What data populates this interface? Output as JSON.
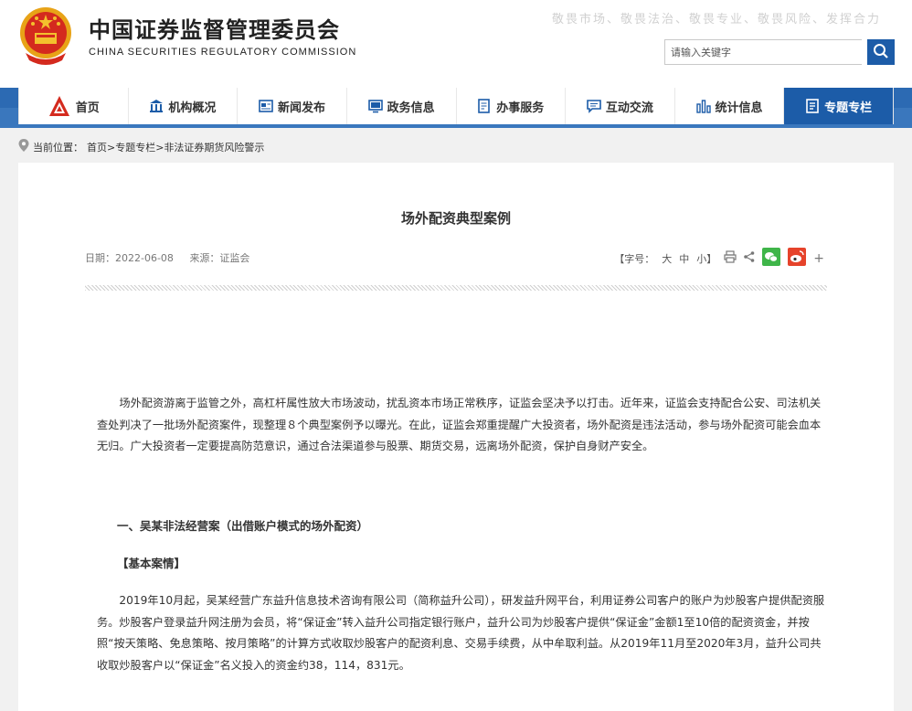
{
  "header": {
    "cn_title": "中国证券监督管理委员会",
    "en_title": "CHINA SECURITIES REGULATORY COMMISSION",
    "slogan": "敬畏市场、敬畏法治、敬畏专业、敬畏风险、发挥合力",
    "search_placeholder": "请输入关键字"
  },
  "nav": {
    "items": [
      {
        "label": "首页",
        "icon": "emblem-icon"
      },
      {
        "label": "机构概况",
        "icon": "institution-icon"
      },
      {
        "label": "新闻发布",
        "icon": "news-icon"
      },
      {
        "label": "政务信息",
        "icon": "monitor-icon"
      },
      {
        "label": "办事服务",
        "icon": "service-icon"
      },
      {
        "label": "互动交流",
        "icon": "chat-icon"
      },
      {
        "label": "统计信息",
        "icon": "chart-icon"
      },
      {
        "label": "专题专栏",
        "icon": "doc-icon"
      }
    ],
    "active_index": 7,
    "accent_color": "#1c5ca8"
  },
  "breadcrumb": {
    "prefix": "当前位置：",
    "home": "首页",
    "sep1": ">",
    "col": "专题专栏",
    "sep2": ">",
    "current": "非法证券期货风险警示"
  },
  "article": {
    "title": "场外配资典型案例",
    "date": "日期：2022-06-08",
    "source": "来源：证监会",
    "font_label": "【字号：",
    "font_large": "大",
    "font_medium": "中",
    "font_small": "小】",
    "plus": "+",
    "intro": "场外配资游离于监管之外，高杠杆属性放大市场波动，扰乱资本市场正常秩序，证监会坚决予以打击。近年来，证监会支持配合公安、司法机关查处判决了一批场外配资案件，现整理８个典型案例予以曝光。在此，证监会郑重提醒广大投资者，场外配资是违法活动，参与场外配资可能会血本无归。广大投资者一定要提高防范意识，通过合法渠道参与股票、期货交易，远离场外配资，保护自身财产安全。",
    "section1": "一、吴某非法经营案（出借账户模式的场外配资）",
    "sub1": "【基本案情】",
    "body1": "2019年10月起，吴某经营广东益升信息技术咨询有限公司（简称益升公司），研发益升网平台，利用证券公司客户的账户为炒股客户提供配资服务。炒股客户登录益升网注册为会员，将“保证金”转入益升公司指定银行账户，益升公司为炒股客户提供“保证金”金额1至10倍的配资资金，并按照“按天策略、免息策略、按月策略”的计算方式收取炒股客户的配资利息、交易手续费，从中牟取利益。从2019年11月至2020年3月，益升公司共收取炒股客户以“保证金”名义投入的资金约38，114，831元。"
  }
}
